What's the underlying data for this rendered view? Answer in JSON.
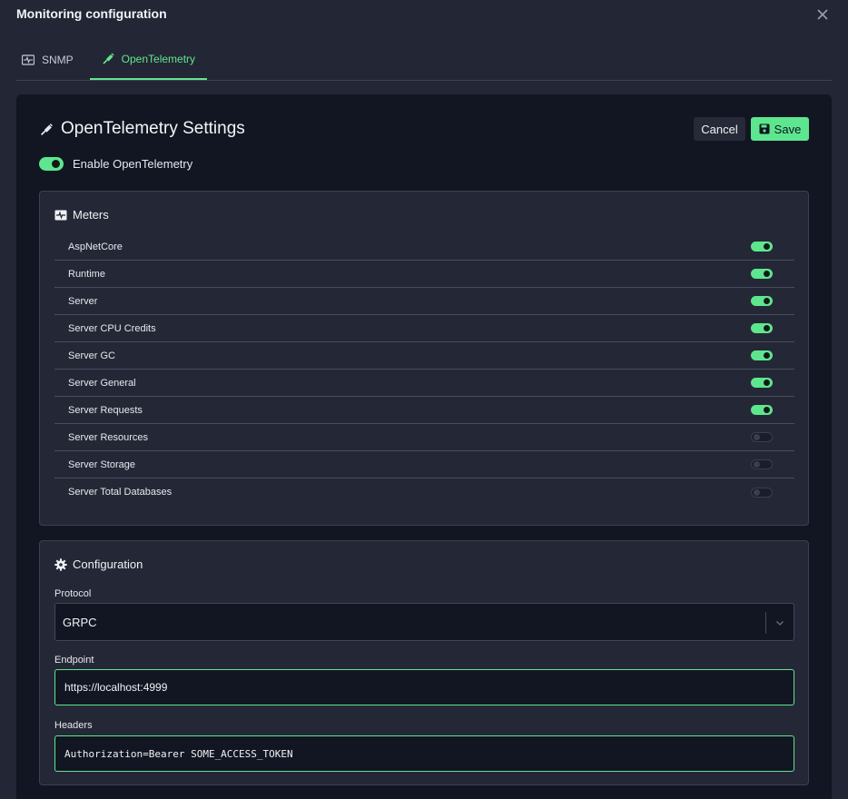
{
  "modal": {
    "title": "Monitoring configuration"
  },
  "tabs": [
    {
      "label": "SNMP",
      "icon": "pulse-icon",
      "active": false
    },
    {
      "label": "OpenTelemetry",
      "icon": "telescope-icon",
      "active": true
    }
  ],
  "settings": {
    "title": "OpenTelemetry Settings",
    "cancel_label": "Cancel",
    "save_label": "Save",
    "enable_label": "Enable OpenTelemetry",
    "enabled": true
  },
  "meters": {
    "title": "Meters",
    "items": [
      {
        "label": "AspNetCore",
        "enabled": true
      },
      {
        "label": "Runtime",
        "enabled": true
      },
      {
        "label": "Server",
        "enabled": true
      },
      {
        "label": "Server CPU Credits",
        "enabled": true
      },
      {
        "label": "Server GC",
        "enabled": true
      },
      {
        "label": "Server General",
        "enabled": true
      },
      {
        "label": "Server Requests",
        "enabled": true
      },
      {
        "label": "Server Resources",
        "enabled": false
      },
      {
        "label": "Server Storage",
        "enabled": false
      },
      {
        "label": "Server Total Databases",
        "enabled": false
      }
    ]
  },
  "configuration": {
    "title": "Configuration",
    "protocol_label": "Protocol",
    "protocol_value": "GRPC",
    "endpoint_label": "Endpoint",
    "endpoint_value": "https://localhost:4999",
    "headers_label": "Headers",
    "headers_value": "Authorization=Bearer SOME_ACCESS_TOKEN"
  },
  "colors": {
    "accent": "#5ee68f",
    "background": "#232634",
    "panel": "#121623",
    "card": "#242836"
  }
}
